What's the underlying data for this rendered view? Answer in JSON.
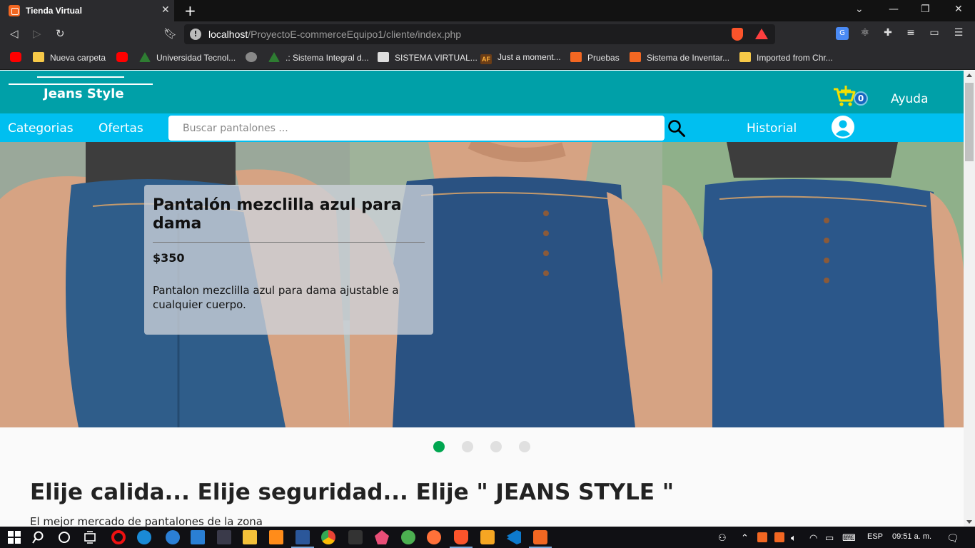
{
  "browser": {
    "tab_title": "Tienda Virtual",
    "url_host": "localhost",
    "url_path": "/ProyectoE-commerceEquipo1/cliente/index.php",
    "bookmarks": [
      {
        "label": "",
        "icon": "youtube-icon"
      },
      {
        "label": "Nueva carpeta",
        "icon": "folder-icon"
      },
      {
        "label": "",
        "icon": "youtube-icon"
      },
      {
        "label": "Universidad Tecnol...",
        "icon": "university-icon"
      },
      {
        "label": "",
        "icon": "globe-icon"
      },
      {
        "label": ".: Sistema Integral d...",
        "icon": "university-icon"
      },
      {
        "label": "SISTEMA VIRTUAL...",
        "icon": "sistema-virtual-icon"
      },
      {
        "label": "Just a moment...",
        "icon": "af-icon"
      },
      {
        "label": "Pruebas",
        "icon": "xampp-icon"
      },
      {
        "label": "Sistema de Inventar...",
        "icon": "xampp-icon"
      },
      {
        "label": "Imported from Chr...",
        "icon": "folder-icon"
      }
    ]
  },
  "header": {
    "brand": "Jeans Style",
    "cart_count": "0",
    "help_label": "Ayuda",
    "brand_color": "#00a0a8"
  },
  "subnav": {
    "categories_label": "Categorias",
    "offers_label": "Ofertas",
    "search_placeholder": "Buscar pantalones ...",
    "history_label": "Historial",
    "bar_color": "#00bff0"
  },
  "carousel": {
    "active_index": 0,
    "total_slides": 4,
    "card": {
      "title": "Pantalón mezclilla azul para dama",
      "price": "$350",
      "description": "Pantalon mezclilla azul para dama ajustable a cualquier cuerpo."
    },
    "active_dot_color": "#00a650"
  },
  "content": {
    "headline": "Elije calida... Elije seguridad... Elije \" JEANS STYLE \"",
    "tagline": "El mejor mercado de pantalones de la zona"
  },
  "taskbar": {
    "language": "ESP",
    "time": "09:51 a. m."
  }
}
